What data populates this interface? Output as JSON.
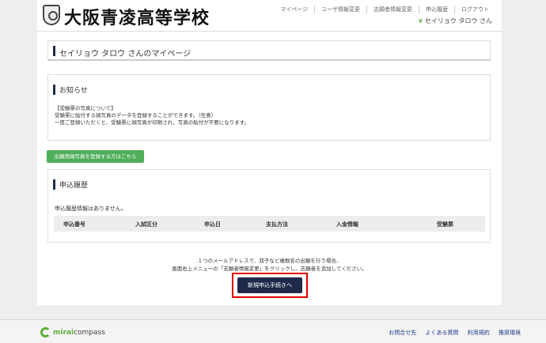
{
  "header": {
    "school_name": "大阪青凌高等学校",
    "nav": [
      "マイページ",
      "ユーザ情報変更",
      "志願者情報変更",
      "申込履歴",
      "ログアウト"
    ],
    "user_name": "セイリョウ タロウ さん"
  },
  "page_title": "セイリョウ タロウ さんのマイページ",
  "notice": {
    "title": "お知らせ",
    "lines": [
      "【受験票の写真について】",
      "受験票に貼付する顔写真のデータを登録することができます。（任意）",
      "一度ご登録いただくと、受験票に顔写真が印刷され、写真の貼付が不要になります。"
    ]
  },
  "photo_button": "出願用顔写真を登録する方はこちら",
  "history": {
    "title": "申込履歴",
    "empty_message": "申込履歴情報はありません。",
    "columns": [
      "申込番号",
      "入試区分",
      "申込日",
      "支払方法",
      "入金情報",
      "受験票"
    ]
  },
  "info_lines": [
    "１つのメールアドレスで、双子など複数名の出願を行う場合、",
    "画面右上メニューの「志願者情報変更」をクリックし、志願者を追加してください。"
  ],
  "new_application_button": "新規申込手続きへ",
  "footer": {
    "logo_bold": "mirai",
    "logo_rest": "compass",
    "links": [
      "お問合せ先",
      "よくある質問",
      "利用規約",
      "推奨環境"
    ]
  },
  "colors": {
    "accent_navy": "#1f2a4a",
    "button_green": "#4fae5a",
    "highlight_red": "#e30000"
  }
}
